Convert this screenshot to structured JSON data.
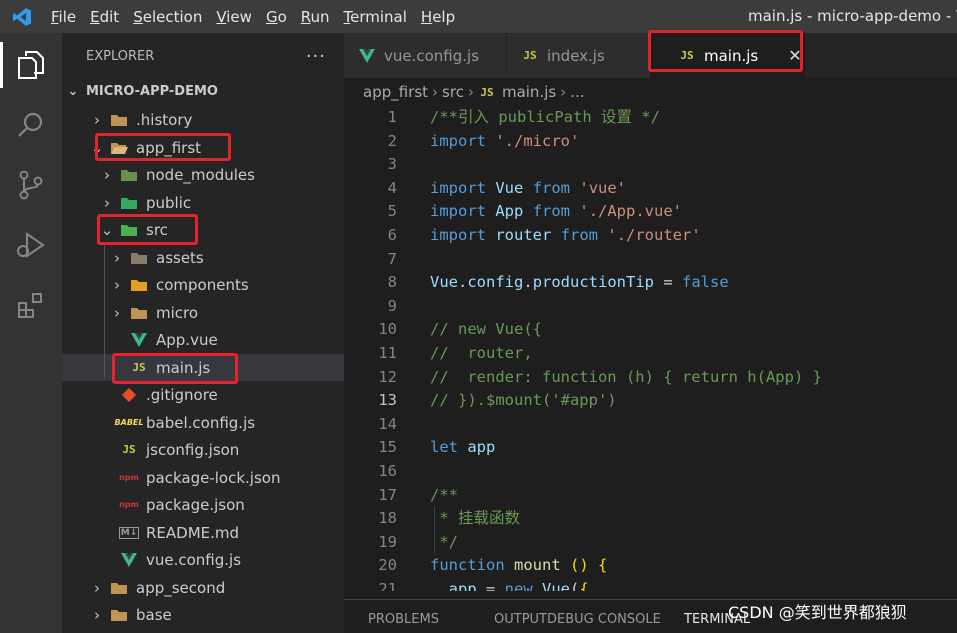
{
  "menu": [
    "File",
    "Edit",
    "Selection",
    "View",
    "Go",
    "Run",
    "Terminal",
    "Help"
  ],
  "window_title": "main.js - micro-app-demo - Visu",
  "activity_icons": [
    "explorer-icon",
    "search-icon",
    "source-control-icon",
    "run-debug-icon",
    "extensions-icon"
  ],
  "explorer": {
    "title": "EXPLORER",
    "more": "···",
    "root": "MICRO-APP-DEMO",
    "items": [
      {
        "label": ".history",
        "icon": "folder"
      },
      {
        "label": "app_first",
        "icon": "folder-open"
      },
      {
        "label": "node_modules",
        "icon": "node-folder"
      },
      {
        "label": "public",
        "icon": "public-folder"
      },
      {
        "label": "src",
        "icon": "src-folder"
      },
      {
        "label": "assets",
        "icon": "assets-folder"
      },
      {
        "label": "components",
        "icon": "components-folder"
      },
      {
        "label": "micro",
        "icon": "folder"
      },
      {
        "label": "App.vue",
        "icon": "vue-file"
      },
      {
        "label": "main.js",
        "icon": "js-file"
      },
      {
        "label": ".gitignore",
        "icon": "git-file"
      },
      {
        "label": "babel.config.js",
        "icon": "babel-file"
      },
      {
        "label": "jsconfig.json",
        "icon": "js-file"
      },
      {
        "label": "package-lock.json",
        "icon": "npm-file"
      },
      {
        "label": "package.json",
        "icon": "npm-file"
      },
      {
        "label": "README.md",
        "icon": "markdown-file"
      },
      {
        "label": "vue.config.js",
        "icon": "vue-file"
      },
      {
        "label": "app_second",
        "icon": "folder"
      },
      {
        "label": "base",
        "icon": "folder"
      }
    ]
  },
  "tabs": [
    {
      "label": "vue.config.js",
      "icon": "vue-file",
      "active": false
    },
    {
      "label": "index.js",
      "icon": "js-file",
      "active": false
    },
    {
      "label": "main.js",
      "icon": "js-file",
      "active": true,
      "close": "✕"
    }
  ],
  "js_badge": "JS",
  "breadcrumb": [
    "app_first",
    "src",
    "main.js",
    "..."
  ],
  "code_lines": [
    {
      "n": "1",
      "html": "<span class=\"c\">/**引入 publicPath 设置 */</span>"
    },
    {
      "n": "2",
      "html": "<span class=\"k\">import</span> <span class=\"s\">'./micro'</span>"
    },
    {
      "n": "3",
      "html": ""
    },
    {
      "n": "4",
      "html": "<span class=\"k\">import</span> <span class=\"v\">Vue</span> <span class=\"k\">from</span> <span class=\"s\">'vue'</span>"
    },
    {
      "n": "5",
      "html": "<span class=\"k\">import</span> <span class=\"v\">App</span> <span class=\"k\">from</span> <span class=\"s\">'./App.vue'</span>"
    },
    {
      "n": "6",
      "html": "<span class=\"k\">import</span> <span class=\"v\">router</span> <span class=\"k\">from</span> <span class=\"s\">'./router'</span>"
    },
    {
      "n": "7",
      "html": ""
    },
    {
      "n": "8",
      "html": "<span class=\"v\">Vue</span>.<span class=\"v\">config</span>.<span class=\"v\">productionTip</span> = <span class=\"k\">false</span>"
    },
    {
      "n": "9",
      "html": ""
    },
    {
      "n": "10",
      "html": "<span class=\"c\">// new Vue({</span>"
    },
    {
      "n": "11",
      "html": "<span class=\"c\">//  router,</span>"
    },
    {
      "n": "12",
      "html": "<span class=\"c\">//  render: function (h) { return h(App) }</span>"
    },
    {
      "n": "13",
      "html": "<span class=\"c\">// }).$mount('#app')</span>"
    },
    {
      "n": "14",
      "html": ""
    },
    {
      "n": "15",
      "html": "<span class=\"k\">let</span> <span class=\"v\">app</span>"
    },
    {
      "n": "16",
      "html": ""
    },
    {
      "n": "17",
      "html": "<span class=\"c\">/**</span>"
    },
    {
      "n": "18",
      "html": "<span class=\"c\"> * 挂载函数</span>"
    },
    {
      "n": "19",
      "html": "<span class=\"c\"> */</span>"
    },
    {
      "n": "20",
      "html": "<span class=\"k\">function</span> <span class=\"f\">mount</span> <span class=\"y\">()</span> <span class=\"y\">{</span>"
    },
    {
      "n": "21",
      "html": "  <span class=\"v\">app</span> = <span class=\"k\">new</span> <span class=\"v\">Vue</span>(<span class=\"y\">{</span>"
    }
  ],
  "current_line": "13",
  "panel_tabs": [
    "PROBLEMS",
    "OUTPUT",
    "DEBUG CONSOLE",
    "TERMINAL"
  ],
  "watermark": "CSDN @笑到世界都狼狈",
  "colors": {
    "highlight": "#e8212f",
    "accent_blue": "#007acc"
  }
}
